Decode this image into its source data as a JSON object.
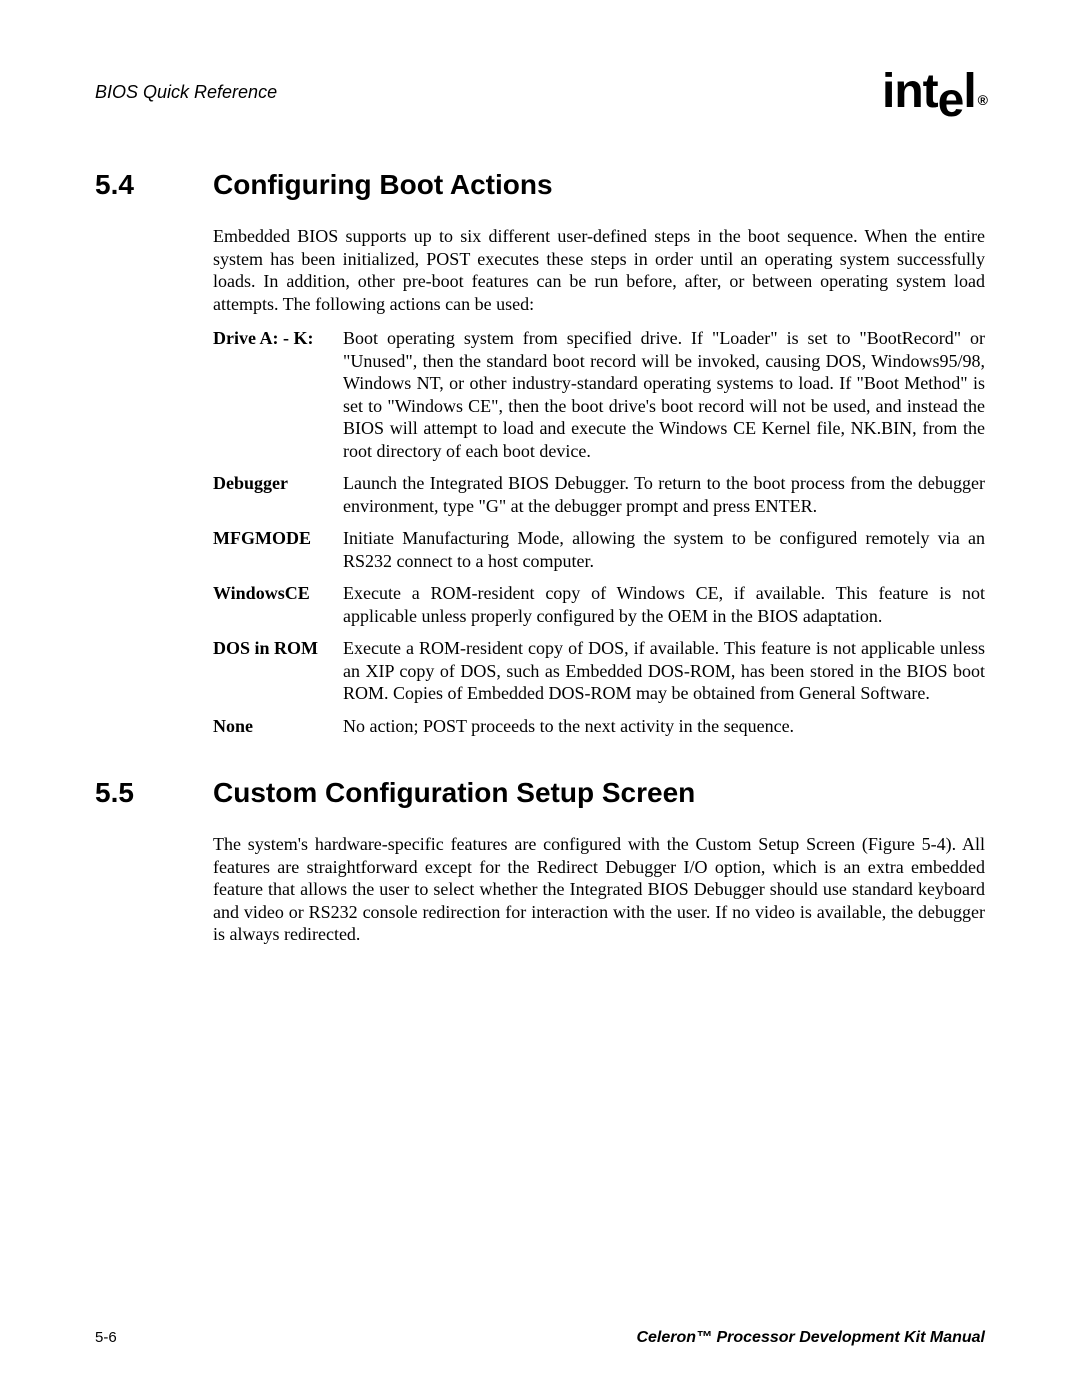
{
  "header": {
    "title": "BIOS Quick Reference",
    "logo_text": "int",
    "logo_suffix": "el",
    "logo_reg": "®"
  },
  "sections": [
    {
      "number": "5.4",
      "title": "Configuring Boot Actions",
      "intro": "Embedded BIOS supports up to six different user-defined steps in the boot sequence. When the entire system has been initialized, POST executes these steps in order until an operating system successfully loads. In addition, other pre-boot features can be run before, after, or between operating system load attempts. The following actions can be used:",
      "definitions": [
        {
          "term": "Drive A: - K:",
          "desc": "Boot operating system from specified drive. If \"Loader\" is set to \"BootRecord\" or \"Unused\", then the standard boot record will be invoked, causing DOS, Windows95/98, Windows NT, or other industry-standard operating systems to load. If \"Boot Method\" is set to \"Windows CE\", then the boot drive's boot record will not be used, and instead the BIOS will attempt to load and execute the Windows CE Kernel file, NK.BIN, from the root directory of each boot device."
        },
        {
          "term": "Debugger",
          "desc": "Launch the Integrated BIOS Debugger. To return to the boot process from the debugger environment, type \"G\" at the debugger prompt and press ENTER."
        },
        {
          "term": "MFGMODE",
          "desc": "Initiate Manufacturing Mode, allowing the system to be configured remotely via an RS232 connect to a host computer."
        },
        {
          "term": "WindowsCE",
          "desc": "Execute a ROM-resident copy of Windows CE, if available. This feature is not applicable unless properly configured by the OEM in the BIOS adaptation."
        },
        {
          "term": "DOS in ROM",
          "desc": "Execute a ROM-resident copy of DOS, if available. This feature is not applicable unless an XIP copy of DOS, such as Embedded DOS-ROM, has been stored in the BIOS boot ROM. Copies of Embedded DOS-ROM may be obtained from General Software."
        },
        {
          "term": "None",
          "desc": "No action; POST proceeds to the next activity in the sequence."
        }
      ]
    },
    {
      "number": "5.5",
      "title": "Custom Configuration Setup Screen",
      "intro": "The system's hardware-specific features are configured with the Custom Setup Screen (Figure 5-4). All features are straightforward except for the Redirect Debugger I/O option, which is an extra embedded feature that allows the user to select whether the Integrated BIOS Debugger should use standard keyboard and video or RS232 console redirection for interaction with the user. If no video is available, the debugger is always redirected."
    }
  ],
  "footer": {
    "page_number": "5-6",
    "manual_title": "Celeron™ Processor Development Kit Manual"
  }
}
